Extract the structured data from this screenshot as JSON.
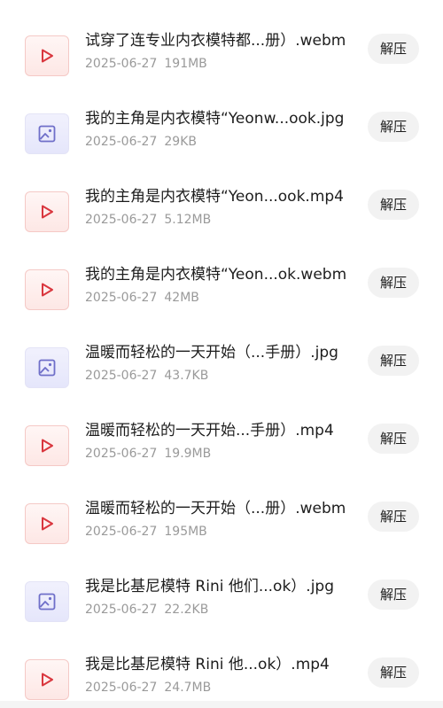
{
  "files": [
    {
      "type": "video",
      "icon": "play-icon",
      "name": "试穿了连专业内衣模特都...册）.webm",
      "date": "2025-06-27",
      "size": "191MB",
      "action": "解压"
    },
    {
      "type": "image",
      "icon": "image-icon",
      "name": "我的主角是内衣模特“Yeonw...ook.jpg",
      "date": "2025-06-27",
      "size": "29KB",
      "action": "解压"
    },
    {
      "type": "video",
      "icon": "play-icon",
      "name": "我的主角是内衣模特“Yeon...ook.mp4",
      "date": "2025-06-27",
      "size": "5.12MB",
      "action": "解压"
    },
    {
      "type": "video",
      "icon": "play-icon",
      "name": "我的主角是内衣模特“Yeon...ok.webm",
      "date": "2025-06-27",
      "size": "42MB",
      "action": "解压"
    },
    {
      "type": "image",
      "icon": "image-icon",
      "name": "温暖而轻松的一天开始（...手册）.jpg",
      "date": "2025-06-27",
      "size": "43.7KB",
      "action": "解压"
    },
    {
      "type": "video",
      "icon": "play-icon",
      "name": "温暖而轻松的一天开始...手册）.mp4",
      "date": "2025-06-27",
      "size": "19.9MB",
      "action": "解压"
    },
    {
      "type": "video",
      "icon": "play-icon",
      "name": "温暖而轻松的一天开始（...册）.webm",
      "date": "2025-06-27",
      "size": "195MB",
      "action": "解压"
    },
    {
      "type": "image",
      "icon": "image-icon",
      "name": "我是比基尼模特 Rini  他们...ok）.jpg",
      "date": "2025-06-27",
      "size": "22.2KB",
      "action": "解压"
    },
    {
      "type": "video",
      "icon": "play-icon",
      "name": "我是比基尼模特 Rini  他...ok）.mp4",
      "date": "2025-06-27",
      "size": "24.7MB",
      "action": "解压"
    }
  ],
  "colors": {
    "video_accent": "#d9363e",
    "image_accent": "#6f6fc9",
    "button_bg": "#f2f2f2",
    "meta_text": "#9a9a9a"
  }
}
